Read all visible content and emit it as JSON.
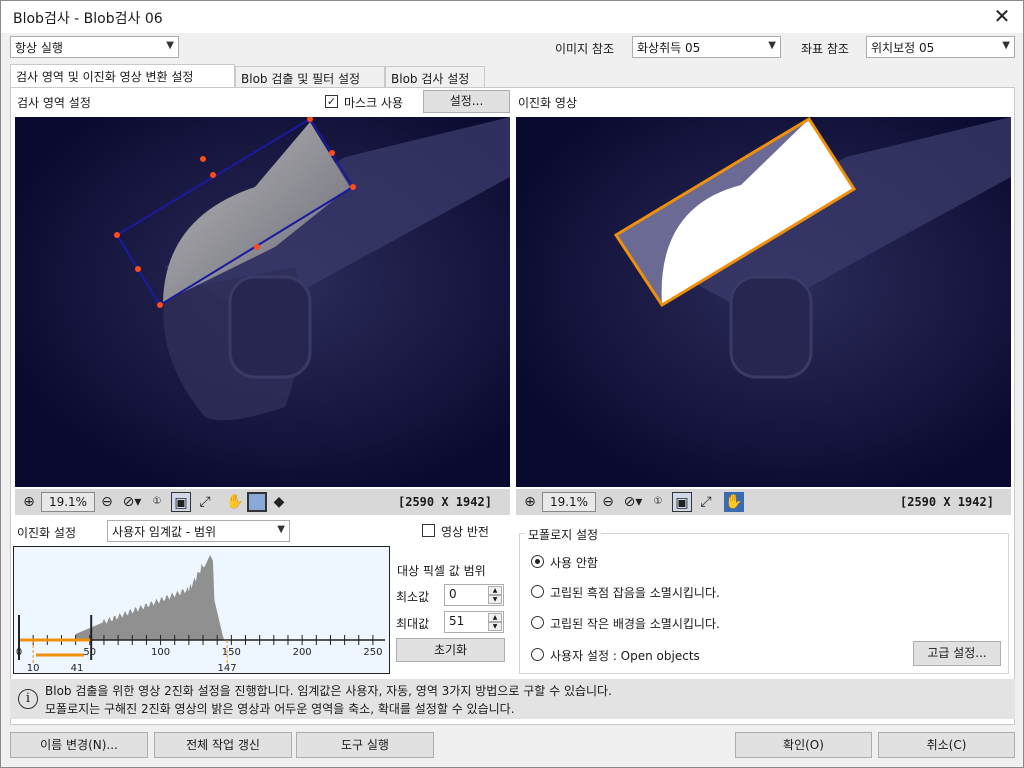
{
  "window": {
    "title": "Blob검사 - Blob검사 06"
  },
  "top": {
    "run_mode": "항상 실행",
    "image_ref_label": "이미지 참조",
    "image_ref_value": "화상취득 05",
    "coord_ref_label": "좌표 참조",
    "coord_ref_value": "위치보정 05"
  },
  "tabs": [
    {
      "label": "검사 영역 및 이진화 영상 변환 설정"
    },
    {
      "label": "Blob 검출 및 필터 설정"
    },
    {
      "label": "Blob 검사 설정"
    }
  ],
  "left_view": {
    "title": "검사 영역 설정",
    "mask_label": "마스크 사용",
    "settings_button": "설정...",
    "zoom": "19.1%",
    "dims": "[2590 X 1942]"
  },
  "right_view": {
    "title": "이진화 영상",
    "zoom": "19.1%",
    "dims": "[2590 X 1942]"
  },
  "binarize": {
    "label": "이진화 설정",
    "mode": "사용자 임계값 - 범위",
    "invert_label": "영상 반전",
    "range_title": "대상 픽셀 값 범위",
    "min_label": "최소값",
    "min_value": "0",
    "max_label": "최대값",
    "max_value": "51",
    "reset_button": "초기화"
  },
  "histogram": {
    "tick_labels": [
      "0",
      "50",
      "100",
      "150",
      "200",
      "250"
    ],
    "marker_labels": [
      "10",
      "41",
      "147"
    ],
    "threshold_min": 0,
    "threshold_max": 51,
    "peak_bin": 135
  },
  "morphology": {
    "title": "모폴로지 설정",
    "options": [
      {
        "label": "사용 안함",
        "selected": true
      },
      {
        "label": "고립된 흑점 잡음을 소멸시킵니다.",
        "selected": false
      },
      {
        "label": "고립된 작은 배경을 소멸시킵니다.",
        "selected": false
      },
      {
        "label": "사용자 설정 : Open objects",
        "selected": false
      }
    ],
    "advanced_button": "고급 설정..."
  },
  "info": {
    "line1": "Blob 검출을 위한 영상 2진화 설정을 진행합니다. 임계값은 사용자, 자동, 영역 3가지 방법으로 구할 수 있습니다.",
    "line2": "모폴로지는 구해진 2진화 영상의 밝은 영상과 어두운 영역을 축소, 확대를 설정할 수 있습니다."
  },
  "bottom": {
    "rename": "이름 변경(N)...",
    "refresh_all": "전체 작업 갱신",
    "run_tool": "도구 실행",
    "ok": "확인(O)",
    "cancel": "취소(C)"
  },
  "colors": {
    "roi_left": "#1a1aa0",
    "roi_right": "#f0900a",
    "handles": "#ff4a1a",
    "image_bg": "#0c0c35",
    "hist_bg": "#eef6ff"
  }
}
